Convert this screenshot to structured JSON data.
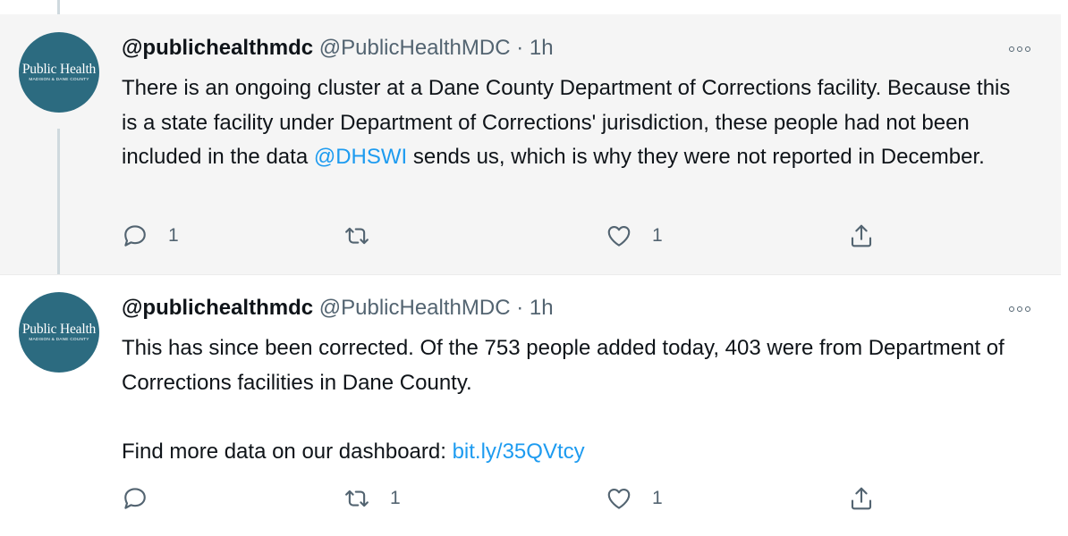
{
  "tweets": [
    {
      "avatar": {
        "brand": "Public Health",
        "sub": "Madison & Dane County"
      },
      "display_name": "@publichealthmdc",
      "handle": "@PublicHealthMDC",
      "separator": "·",
      "time": "1h",
      "text_segments": {
        "part1": "There is an ongoing cluster at a Dane County Department of Corrections facility. Because this is a state facility under Department of Corrections' jurisdiction, these people had not been included in the data ",
        "mention": "@DHSWI",
        "part2": " sends us, which is why they were not reported in December."
      },
      "replies": "1",
      "retweets": "",
      "likes": "1"
    },
    {
      "avatar": {
        "brand": "Public Health",
        "sub": "Madison & Dane County"
      },
      "display_name": "@publichealthmdc",
      "handle": "@PublicHealthMDC",
      "separator": "·",
      "time": "1h",
      "text_segments": {
        "line1": "This has since been corrected. Of the 753 people added today, 403 were from Department of Corrections facilities in Dane County.",
        "line2_prefix": "Find more data on our dashboard: ",
        "link": "bit.ly/35QVtcy"
      },
      "replies": "",
      "retweets": "1",
      "likes": "1"
    }
  ],
  "icons": {
    "reply": "reply-icon",
    "retweet": "retweet-icon",
    "like": "heart-icon",
    "share": "share-icon",
    "more": "more-icon"
  },
  "colors": {
    "link": "#1d9bf0",
    "secondary_text": "#536471",
    "avatar_bg": "#2c6b80",
    "highlight_bg": "#f5f5f5"
  }
}
